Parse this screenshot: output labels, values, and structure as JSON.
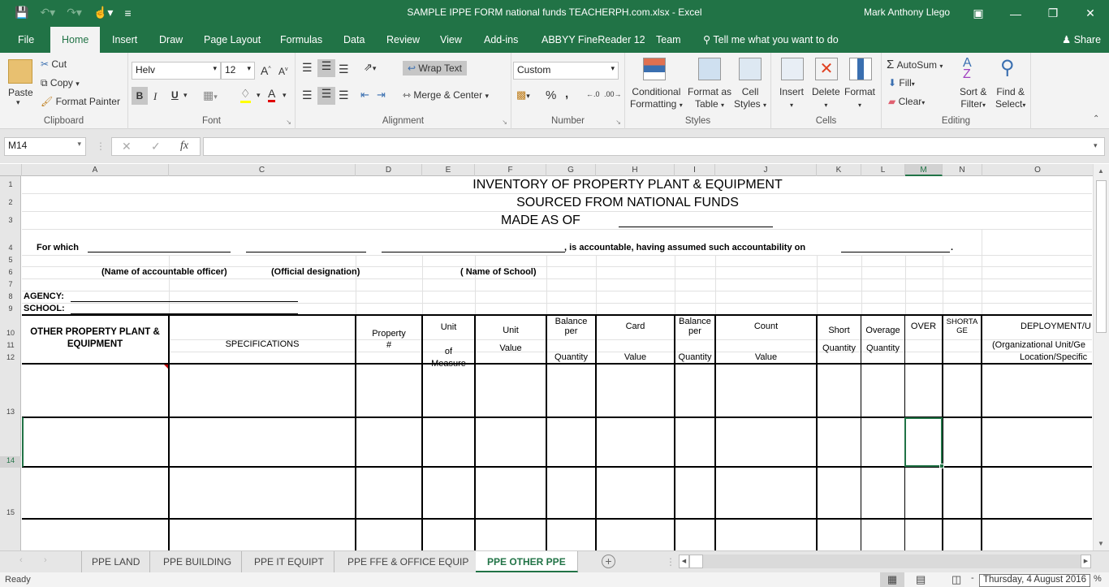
{
  "window": {
    "title": "SAMPLE IPPE FORM national funds  TEACHERPH.com.xlsx - Excel",
    "user": "Mark Anthony Llego"
  },
  "menu_tabs": [
    {
      "label": "File"
    },
    {
      "label": "Home"
    },
    {
      "label": "Insert"
    },
    {
      "label": "Draw"
    },
    {
      "label": "Page Layout"
    },
    {
      "label": "Formulas"
    },
    {
      "label": "Data"
    },
    {
      "label": "Review"
    },
    {
      "label": "View"
    },
    {
      "label": "Add-ins"
    },
    {
      "label": "ABBYY FineReader 12"
    },
    {
      "label": "Team"
    }
  ],
  "tell_me": "Tell me what you want to do",
  "share": "Share",
  "ribbon": {
    "clipboard": {
      "label": "Clipboard",
      "paste": "Paste",
      "cut": "Cut",
      "copy": "Copy",
      "format_painter": "Format Painter"
    },
    "font": {
      "label": "Font",
      "name": "Helv",
      "size": "12",
      "bold": "B",
      "italic": "I",
      "underline": "U"
    },
    "alignment": {
      "label": "Alignment",
      "wrap_text": "Wrap Text",
      "merge_center": "Merge & Center"
    },
    "number": {
      "label": "Number",
      "format": "Custom",
      "percent": "%",
      "comma": ","
    },
    "styles": {
      "label": "Styles",
      "conditional_1": "Conditional",
      "conditional_2": "Formatting",
      "format_table_1": "Format as",
      "format_table_2": "Table",
      "cell_styles_1": "Cell",
      "cell_styles_2": "Styles"
    },
    "cells": {
      "label": "Cells",
      "insert": "Insert",
      "delete": "Delete",
      "format": "Format"
    },
    "editing": {
      "label": "Editing",
      "autosum": "AutoSum",
      "fill": "Fill",
      "clear": "Clear",
      "sort_1": "Sort &",
      "sort_2": "Filter",
      "find_1": "Find &",
      "find_2": "Select"
    }
  },
  "formula_bar": {
    "name_box": "M14",
    "formula": "",
    "fx": "fx"
  },
  "columns": [
    "A",
    "C",
    "D",
    "E",
    "F",
    "G",
    "H",
    "I",
    "J",
    "K",
    "L",
    "M",
    "N",
    "O"
  ],
  "rows": [
    "1",
    "2",
    "3",
    "4",
    "5",
    "6",
    "7",
    "8",
    "9",
    "10",
    "11",
    "12",
    "13",
    "14",
    "15"
  ],
  "sheet": {
    "title1": "INVENTORY OF PROPERTY PLANT & EQUIPMENT",
    "title2": "SOURCED FROM NATIONAL FUNDS",
    "title3": "MADE AS OF",
    "for_which": "For which",
    "accountable": ",  is accountable, having assumed such accountability on",
    "period": ".",
    "name_officer": "(Name of accountable officer)",
    "designation": "(Official designation)",
    "school_name": "( Name of School)",
    "agency": "AGENCY:",
    "school": "SCHOOL:",
    "headers": {
      "ppe_1": "OTHER PROPERTY PLANT &",
      "ppe_2": "EQUIPMENT",
      "specifications": "SPECIFICATIONS",
      "property_1": "Property",
      "property_2": "#",
      "uom_1": "Unit",
      "uom_2": "of",
      "uom_3": "Measure",
      "uv_1": "Unit",
      "uv_2": "Value",
      "bal_card_qty_1": "Balance",
      "bal_card_qty_2": "per",
      "bal_card_qty_3": "Quantity",
      "card": "Card",
      "card_value": "Value",
      "bal_count_qty_1": "Balance",
      "bal_count_qty_2": "per",
      "bal_count_qty_3": "Quantity",
      "count": "Count",
      "count_value": "Value",
      "short_1": "Short",
      "short_2": "Quantity",
      "overage_1": "Overage",
      "overage_2": "Quantity",
      "over": "OVER",
      "shortage_1": "SHORTA",
      "shortage_2": "GE",
      "deploy_1": "DEPLOYMENT/U",
      "deploy_2": "(Organizational Unit/Ge",
      "deploy_3": "Location/Specific"
    }
  },
  "sheet_tabs": [
    {
      "label": "PPE LAND",
      "active": false
    },
    {
      "label": "PPE BUILDING",
      "active": false
    },
    {
      "label": "PPE IT EQUIPT",
      "active": false
    },
    {
      "label": "PPE FFE & OFFICE EQUIP",
      "active": false
    },
    {
      "label": "PPE OTHER PPE",
      "active": true
    }
  ],
  "status": {
    "ready": "Ready",
    "tooltip": "Thursday, 4 August 2016"
  },
  "colors": {
    "brand": "#217346"
  }
}
